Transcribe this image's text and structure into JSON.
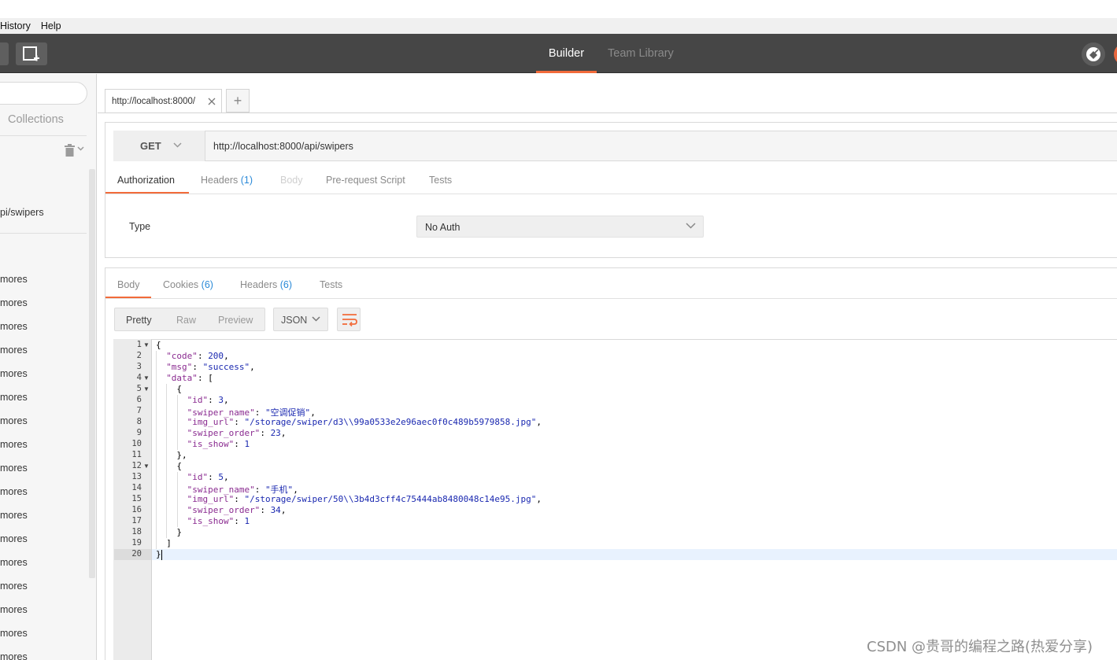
{
  "menu": {
    "history": "History",
    "help": "Help"
  },
  "header": {
    "builder_tab": "Builder",
    "team_tab": "Team Library"
  },
  "sidebar": {
    "collections_label": "Collections",
    "items": [
      "pi/swipers",
      "mores",
      "mores",
      "mores",
      "mores",
      "mores",
      "mores",
      "mores",
      "mores",
      "mores",
      "mores",
      "mores",
      "mores",
      "mores",
      "mores",
      "mores",
      "mores",
      "mores"
    ]
  },
  "request": {
    "tab_label": "http://localhost:8000/",
    "new_tab": "+",
    "method": "GET",
    "url": "http://localhost:8000/api/swipers",
    "tabs": {
      "authorization": "Authorization",
      "headers": "Headers",
      "headers_count": "(1)",
      "body": "Body",
      "prerequest": "Pre-request Script",
      "tests": "Tests"
    },
    "auth_type_label": "Type",
    "auth_type_value": "No Auth"
  },
  "response": {
    "tabs": {
      "body": "Body",
      "cookies": "Cookies",
      "cookies_count": "(6)",
      "headers": "Headers",
      "headers_count": "(6)",
      "tests": "Tests"
    },
    "view_modes": {
      "pretty": "Pretty",
      "raw": "Raw",
      "preview": "Preview"
    },
    "format": "JSON",
    "lines": [
      {
        "n": "1",
        "fold": true,
        "indent": 0,
        "parts": [
          [
            "p",
            "{"
          ]
        ]
      },
      {
        "n": "2",
        "fold": false,
        "indent": 1,
        "parts": [
          [
            "k",
            "\"code\""
          ],
          [
            "p",
            ": "
          ],
          [
            "n",
            "200"
          ],
          [
            "p",
            ","
          ]
        ]
      },
      {
        "n": "3",
        "fold": false,
        "indent": 1,
        "parts": [
          [
            "k",
            "\"msg\""
          ],
          [
            "p",
            ": "
          ],
          [
            "s",
            "\"success\""
          ],
          [
            "p",
            ","
          ]
        ]
      },
      {
        "n": "4",
        "fold": true,
        "indent": 1,
        "parts": [
          [
            "k",
            "\"data\""
          ],
          [
            "p",
            ": ["
          ]
        ]
      },
      {
        "n": "5",
        "fold": true,
        "indent": 2,
        "parts": [
          [
            "p",
            "{"
          ]
        ]
      },
      {
        "n": "6",
        "fold": false,
        "indent": 3,
        "parts": [
          [
            "k",
            "\"id\""
          ],
          [
            "p",
            ": "
          ],
          [
            "n",
            "3"
          ],
          [
            "p",
            ","
          ]
        ]
      },
      {
        "n": "7",
        "fold": false,
        "indent": 3,
        "parts": [
          [
            "k",
            "\"swiper_name\""
          ],
          [
            "p",
            ": "
          ],
          [
            "s",
            "\"空调促销\""
          ],
          [
            "p",
            ","
          ]
        ]
      },
      {
        "n": "8",
        "fold": false,
        "indent": 3,
        "parts": [
          [
            "k",
            "\"img_url\""
          ],
          [
            "p",
            ": "
          ],
          [
            "s",
            "\"/storage/swiper/d3\\\\99a0533e2e96aec0f0c489b5979858.jpg\""
          ],
          [
            "p",
            ","
          ]
        ]
      },
      {
        "n": "9",
        "fold": false,
        "indent": 3,
        "parts": [
          [
            "k",
            "\"swiper_order\""
          ],
          [
            "p",
            ": "
          ],
          [
            "n",
            "23"
          ],
          [
            "p",
            ","
          ]
        ]
      },
      {
        "n": "10",
        "fold": false,
        "indent": 3,
        "parts": [
          [
            "k",
            "\"is_show\""
          ],
          [
            "p",
            ": "
          ],
          [
            "n",
            "1"
          ]
        ]
      },
      {
        "n": "11",
        "fold": false,
        "indent": 2,
        "parts": [
          [
            "p",
            "},"
          ]
        ]
      },
      {
        "n": "12",
        "fold": true,
        "indent": 2,
        "parts": [
          [
            "p",
            "{"
          ]
        ]
      },
      {
        "n": "13",
        "fold": false,
        "indent": 3,
        "parts": [
          [
            "k",
            "\"id\""
          ],
          [
            "p",
            ": "
          ],
          [
            "n",
            "5"
          ],
          [
            "p",
            ","
          ]
        ]
      },
      {
        "n": "14",
        "fold": false,
        "indent": 3,
        "parts": [
          [
            "k",
            "\"swiper_name\""
          ],
          [
            "p",
            ": "
          ],
          [
            "s",
            "\"手机\""
          ],
          [
            "p",
            ","
          ]
        ]
      },
      {
        "n": "15",
        "fold": false,
        "indent": 3,
        "parts": [
          [
            "k",
            "\"img_url\""
          ],
          [
            "p",
            ": "
          ],
          [
            "s",
            "\"/storage/swiper/50\\\\3b4d3cff4c75444ab8480048c14e95.jpg\""
          ],
          [
            "p",
            ","
          ]
        ]
      },
      {
        "n": "16",
        "fold": false,
        "indent": 3,
        "parts": [
          [
            "k",
            "\"swiper_order\""
          ],
          [
            "p",
            ": "
          ],
          [
            "n",
            "34"
          ],
          [
            "p",
            ","
          ]
        ]
      },
      {
        "n": "17",
        "fold": false,
        "indent": 3,
        "parts": [
          [
            "k",
            "\"is_show\""
          ],
          [
            "p",
            ": "
          ],
          [
            "n",
            "1"
          ]
        ]
      },
      {
        "n": "18",
        "fold": false,
        "indent": 2,
        "parts": [
          [
            "p",
            "}"
          ]
        ]
      },
      {
        "n": "19",
        "fold": false,
        "indent": 1,
        "parts": [
          [
            "p",
            "]"
          ]
        ]
      },
      {
        "n": "20",
        "fold": false,
        "indent": 0,
        "parts": [
          [
            "p",
            "}"
          ]
        ]
      }
    ]
  },
  "watermark": "CSDN @贵哥的编程之路(热爱分享)",
  "colors": {
    "accent": "#f26b3a",
    "header_bg": "#464646",
    "link_blue": "#2b8ad8"
  }
}
